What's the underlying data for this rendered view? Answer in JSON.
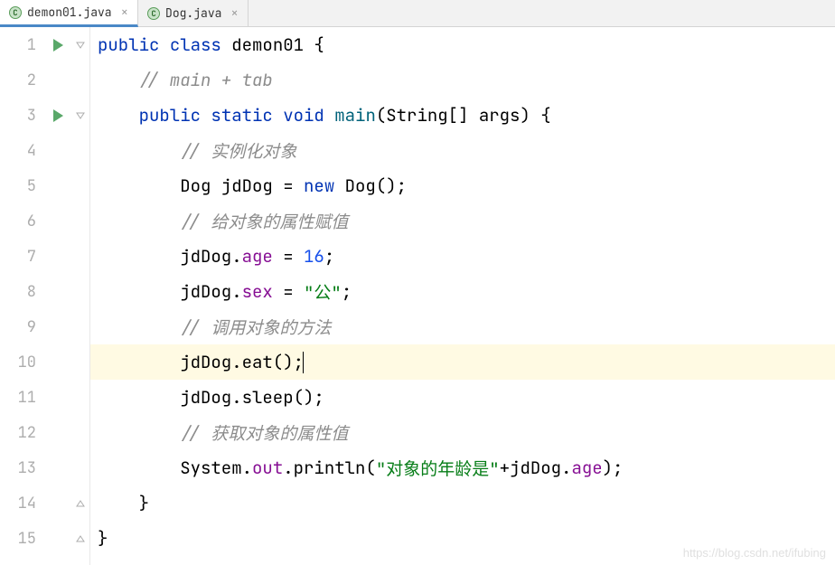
{
  "tabs": [
    {
      "label": "demon01.java",
      "icon": "C",
      "active": true
    },
    {
      "label": "Dog.java",
      "icon": "C",
      "active": false
    }
  ],
  "lineNumbers": [
    "1",
    "2",
    "3",
    "4",
    "5",
    "6",
    "7",
    "8",
    "9",
    "10",
    "11",
    "12",
    "13",
    "14",
    "15"
  ],
  "highlightedLine": 10,
  "runMarkers": [
    1,
    3
  ],
  "code": {
    "l1": {
      "indent": "",
      "tokens": [
        {
          "t": "public",
          "c": "kw"
        },
        {
          "t": " ",
          "c": ""
        },
        {
          "t": "class",
          "c": "kw"
        },
        {
          "t": " demon01 {",
          "c": ""
        }
      ]
    },
    "l2": {
      "indent": "    ",
      "tokens": [
        {
          "t": "// main + tab",
          "c": "com"
        }
      ]
    },
    "l3": {
      "indent": "    ",
      "tokens": [
        {
          "t": "public",
          "c": "kw"
        },
        {
          "t": " ",
          "c": ""
        },
        {
          "t": "static",
          "c": "kw"
        },
        {
          "t": " ",
          "c": ""
        },
        {
          "t": "void",
          "c": "kw"
        },
        {
          "t": " ",
          "c": ""
        },
        {
          "t": "main",
          "c": "fn"
        },
        {
          "t": "(String[] args) {",
          "c": ""
        }
      ]
    },
    "l4": {
      "indent": "        ",
      "tokens": [
        {
          "t": "// 实例化对象",
          "c": "com"
        }
      ]
    },
    "l5": {
      "indent": "        ",
      "tokens": [
        {
          "t": "Dog jdDog = ",
          "c": ""
        },
        {
          "t": "new",
          "c": "kw"
        },
        {
          "t": " Dog();",
          "c": ""
        }
      ]
    },
    "l6": {
      "indent": "        ",
      "tokens": [
        {
          "t": "// 给对象的属性赋值",
          "c": "com"
        }
      ]
    },
    "l7": {
      "indent": "        ",
      "tokens": [
        {
          "t": "jdDog.",
          "c": ""
        },
        {
          "t": "age",
          "c": "field"
        },
        {
          "t": " = ",
          "c": ""
        },
        {
          "t": "16",
          "c": "num"
        },
        {
          "t": ";",
          "c": ""
        }
      ]
    },
    "l8": {
      "indent": "        ",
      "tokens": [
        {
          "t": "jdDog.",
          "c": ""
        },
        {
          "t": "sex",
          "c": "field"
        },
        {
          "t": " = ",
          "c": ""
        },
        {
          "t": "\"公\"",
          "c": "str"
        },
        {
          "t": ";",
          "c": ""
        }
      ]
    },
    "l9": {
      "indent": "        ",
      "tokens": [
        {
          "t": "// 调用对象的方法",
          "c": "com"
        }
      ]
    },
    "l10": {
      "indent": "        ",
      "tokens": [
        {
          "t": "jdDog.eat();",
          "c": ""
        }
      ],
      "cursor": true
    },
    "l11": {
      "indent": "        ",
      "tokens": [
        {
          "t": "jdDog.sleep();",
          "c": ""
        }
      ]
    },
    "l12": {
      "indent": "        ",
      "tokens": [
        {
          "t": "// 获取对象的属性值",
          "c": "com"
        }
      ]
    },
    "l13": {
      "indent": "        ",
      "tokens": [
        {
          "t": "System.",
          "c": ""
        },
        {
          "t": "out",
          "c": "field"
        },
        {
          "t": ".println(",
          "c": ""
        },
        {
          "t": "\"对象的年龄是\"",
          "c": "str"
        },
        {
          "t": "+jdDog.",
          "c": ""
        },
        {
          "t": "age",
          "c": "field"
        },
        {
          "t": ");",
          "c": ""
        }
      ]
    },
    "l14": {
      "indent": "    ",
      "tokens": [
        {
          "t": "}",
          "c": ""
        }
      ]
    },
    "l15": {
      "indent": "",
      "tokens": [
        {
          "t": "}",
          "c": ""
        }
      ]
    }
  },
  "watermark": "https://blog.csdn.net/ifubing"
}
